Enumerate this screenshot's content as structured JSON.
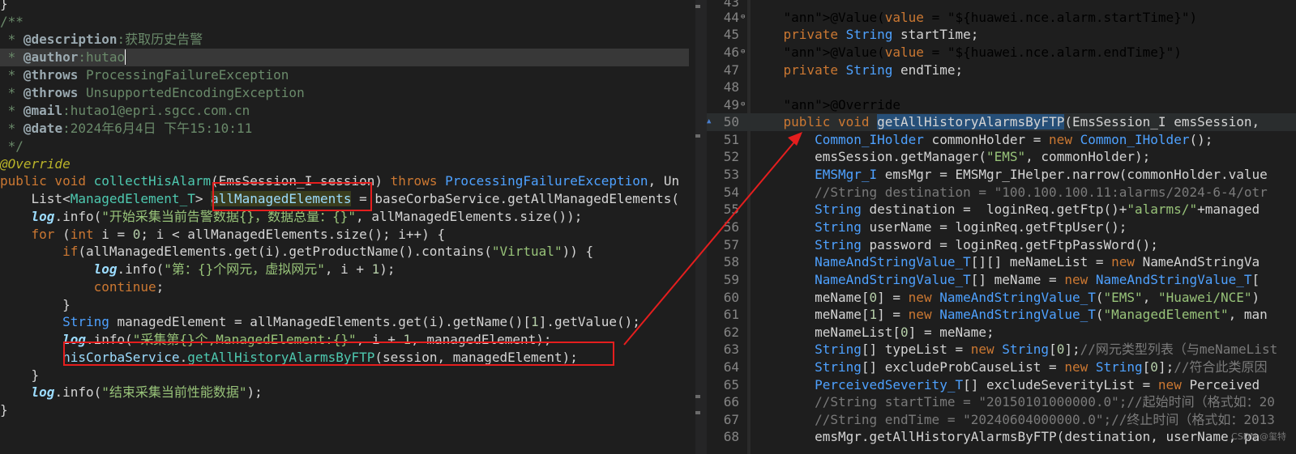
{
  "left_code": [
    "}",
    "/**",
    " * @description:获取历史告警",
    " * @author:hutao",
    " * @throws ProcessingFailureException",
    " * @throws UnsupportedEncodingException",
    " * @mail:hutao1@epri.sgcc.com.cn",
    " * @date:2024年6月4日 下午15:10:11",
    " */",
    "@Override",
    "public void collectHisAlarm(EmsSession_I session) throws ProcessingFailureException, Un",
    "    List<ManagedElement_T> allManagedElements = baseCorbaService.getAllManagedElements(",
    "    log.info(\"开始采集当前告警数据{}，数据总量：{}\", allManagedElements.size());",
    "    for (int i = 0; i < allManagedElements.size(); i++) {",
    "        if(allManagedElements.get(i).getProductName().contains(\"Virtual\")) {",
    "            log.info(\"第：{}个网元，虚拟网元\", i + 1);",
    "            continue;",
    "        }",
    "        String managedElement = allManagedElements.get(i).getName()[1].getValue();",
    "        log.info(\"采集第{}个,ManagedElement:{}\", i + 1, managedElement);",
    "        hisCorbaService.getAllHistoryAlarmsByFTP(session, managedElement);",
    "    }",
    "    log.info(\"结束采集当前性能数据\");",
    "}"
  ],
  "right_lines": [
    {
      "n": "43",
      "code": ""
    },
    {
      "n": "44",
      "code": "    @Value(value = \"${huawei.nce.alarm.startTime}\")"
    },
    {
      "n": "45",
      "code": "    private String startTime;"
    },
    {
      "n": "46",
      "code": "    @Value(value = \"${huawei.nce.alarm.endTime}\")"
    },
    {
      "n": "47",
      "code": "    private String endTime;"
    },
    {
      "n": "48",
      "code": ""
    },
    {
      "n": "49",
      "code": "    @Override"
    },
    {
      "n": "50",
      "code": "    public void getAllHistoryAlarmsByFTP(EmsSession_I emsSession,"
    },
    {
      "n": "51",
      "code": "        Common_IHolder commonHolder = new Common_IHolder();"
    },
    {
      "n": "52",
      "code": "        emsSession.getManager(\"EMS\", commonHolder);"
    },
    {
      "n": "53",
      "code": "        EMSMgr_I emsMgr = EMSMgr_IHelper.narrow(commonHolder.value"
    },
    {
      "n": "54",
      "code": "        //String destination = \"100.100.100.11:alarms/2024-6-4/otr"
    },
    {
      "n": "55",
      "code": "        String destination =  loginReq.getFtp()+\"alarms/\"+managed"
    },
    {
      "n": "56",
      "code": "        String userName = loginReq.getFtpUser();"
    },
    {
      "n": "57",
      "code": "        String password = loginReq.getFtpPassWord();"
    },
    {
      "n": "58",
      "code": "        NameAndStringValue_T[][] meNameList = new NameAndStringVa"
    },
    {
      "n": "59",
      "code": "        NameAndStringValue_T[] meName = new NameAndStringValue_T["
    },
    {
      "n": "60",
      "code": "        meName[0] = new NameAndStringValue_T(\"EMS\", \"Huawei/NCE\")"
    },
    {
      "n": "61",
      "code": "        meName[1] = new NameAndStringValue_T(\"ManagedElement\", man"
    },
    {
      "n": "62",
      "code": "        meNameList[0] = meName;"
    },
    {
      "n": "63",
      "code": "        String[] typeList = new String[0];//网元类型列表（与meNameList"
    },
    {
      "n": "64",
      "code": "        String[] excludeProbCauseList = new String[0];//符合此类原因"
    },
    {
      "n": "65",
      "code": "        PerceivedSeverity_T[] excludeSeverityList = new Perceived"
    },
    {
      "n": "66",
      "code": "        //String startTime = \"20150101000000.0\";//起始时间（格式如：20"
    },
    {
      "n": "67",
      "code": "        //String endTime = \"20240604000000.0\";//终止时间（格式如：2013"
    },
    {
      "n": "68",
      "code": "        emsMgr.getAllHistoryAlarmsByFTP(destination, userName, pa"
    }
  ],
  "watermark": "CSDN @玺特"
}
